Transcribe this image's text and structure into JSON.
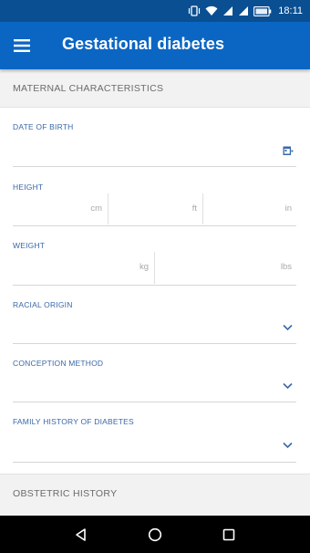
{
  "status_bar": {
    "time": "18:11",
    "icons": [
      "vibrate-icon",
      "wifi-icon",
      "signal-icon",
      "signal-icon",
      "battery-icon"
    ]
  },
  "app_bar": {
    "title": "Gestational diabetes",
    "menu_icon": "hamburger-menu-icon"
  },
  "sections": {
    "maternal": "MATERNAL CHARACTERISTICS",
    "obstetric": "OBSTETRIC HISTORY"
  },
  "fields": {
    "date_of_birth": {
      "label": "DATE OF BIRTH",
      "icon": "calendar-icon"
    },
    "height": {
      "label": "HEIGHT",
      "unit_cm": "cm",
      "unit_ft": "ft",
      "unit_in": "in"
    },
    "weight": {
      "label": "WEIGHT",
      "unit_kg": "kg",
      "unit_lbs": "lbs"
    },
    "racial_origin": {
      "label": "RACIAL ORIGIN",
      "icon": "chevron-down-icon"
    },
    "conception_method": {
      "label": "CONCEPTION METHOD",
      "icon": "chevron-down-icon"
    },
    "family_history": {
      "label": "FAMILY HISTORY OF DIABETES",
      "icon": "chevron-down-icon"
    }
  },
  "nav_bar": {
    "buttons": [
      "back-icon",
      "home-icon",
      "recents-icon"
    ]
  },
  "colors": {
    "status_bar": "#0a4f92",
    "app_bar": "#0b66c3",
    "label": "#3a68a8",
    "section_bg": "#f2f2f2"
  }
}
